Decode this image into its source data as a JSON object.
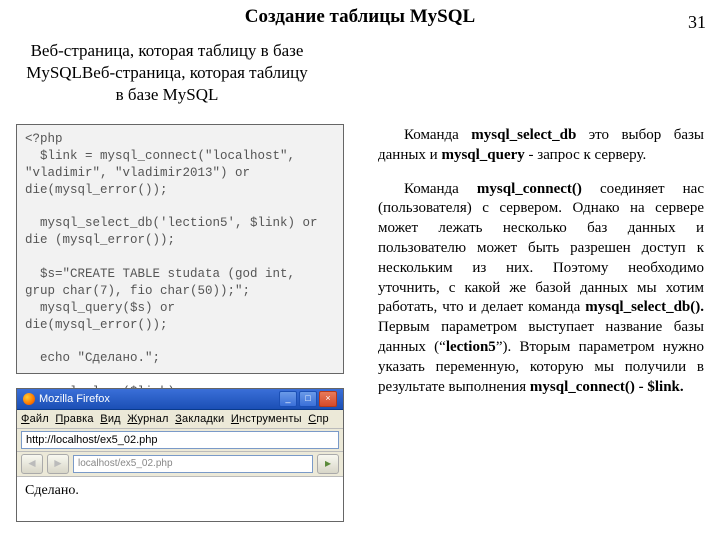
{
  "page_number": "31",
  "title": "Создание таблицы MySQL",
  "subtitle": "Веб-страница, которая таблицу в базе MySQLВеб-страница, которая таблицу в базе MySQL",
  "code": "<?php\n  $link = mysql_connect(\"localhost\",\n\"vladimir\", \"vladimir2013\") or\ndie(mysql_error());\n\n  mysql_select_db('lection5', $link) or\ndie (mysql_error());\n\n  $s=\"CREATE TABLE studata (god int,\ngrup char(7), fio char(50));\";\n  mysql_query($s) or\ndie(mysql_error());\n\n  echo \"Сделано.\";\n\n  mysql_close($link);\n?>",
  "browser": {
    "window_title": "Mozilla Firefox",
    "menu": {
      "file": "Ф",
      "file_r": "айл",
      "edit": "П",
      "edit_r": "равка",
      "view": "В",
      "view_r": "ид",
      "hist": "Ж",
      "hist_r": "урнал",
      "bm": "З",
      "bm_r": "акладки",
      "tools": "И",
      "tools_r": "нструменты",
      "help": "С",
      "help_r": "пр"
    },
    "url_main": "http://localhost/ex5_02.php",
    "url_small": "localhost/ex5_02.php",
    "body_text": "Сделано."
  },
  "right": {
    "p1_a": "Команда ",
    "p1_b": "mysql_select_db",
    "p1_c": "   это выбор базы данных и ",
    "p1_d": "mysql_query",
    "p1_e": " - запрос к серверу.",
    "p2_a": "Команда ",
    "p2_b": "mysql_connect()",
    "p2_c": " соединяет нас (пользователя) с сервером. Однако на сервере может лежать несколько баз данных и пользователю может быть разрешен доступ к нескольким из них. Поэтому необходимо уточнить, с какой же базой данных мы хотим работать, что и делает команда ",
    "p2_d": "mysql_select_db().",
    "p2_e": " Первым параметром выступает название базы данных (“",
    "p2_f": "lection5",
    "p2_g": "”).  Вторым параметром нужно указать переменную, которую мы получили в результате выполнения ",
    "p2_h": "mysql_connect() - $link."
  }
}
